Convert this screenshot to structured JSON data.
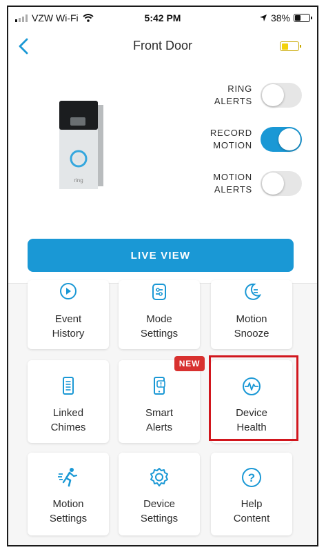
{
  "status_bar": {
    "carrier": "VZW Wi-Fi",
    "time": "5:42 PM",
    "battery_percent": "38%"
  },
  "header": {
    "title": "Front Door",
    "device_battery_level": 0.4
  },
  "toggles": [
    {
      "label_line1": "RING",
      "label_line2": "ALERTS",
      "on": false
    },
    {
      "label_line1": "RECORD",
      "label_line2": "MOTION",
      "on": true
    },
    {
      "label_line1": "MOTION",
      "label_line2": "ALERTS",
      "on": false
    }
  ],
  "live_view_label": "LIVE VIEW",
  "device_brand": "ring",
  "tiles": [
    {
      "line1": "Event",
      "line2": "History",
      "icon": "event-history-icon"
    },
    {
      "line1": "Mode",
      "line2": "Settings",
      "icon": "mode-settings-icon"
    },
    {
      "line1": "Motion",
      "line2": "Snooze",
      "icon": "motion-snooze-icon"
    },
    {
      "line1": "Linked",
      "line2": "Chimes",
      "icon": "linked-chimes-icon"
    },
    {
      "line1": "Smart",
      "line2": "Alerts",
      "icon": "smart-alerts-icon"
    },
    {
      "line1": "Device",
      "line2": "Health",
      "icon": "device-health-icon"
    },
    {
      "line1": "Motion",
      "line2": "Settings",
      "icon": "motion-settings-icon"
    },
    {
      "line1": "Device",
      "line2": "Settings",
      "icon": "device-settings-icon"
    },
    {
      "line1": "Help",
      "line2": "Content",
      "icon": "help-content-icon"
    }
  ],
  "new_badge": "NEW",
  "colors": {
    "accent": "#1a98d5",
    "badge": "#d8312f",
    "highlight": "#d1161d",
    "battery_yellow": "#f3d20a"
  }
}
